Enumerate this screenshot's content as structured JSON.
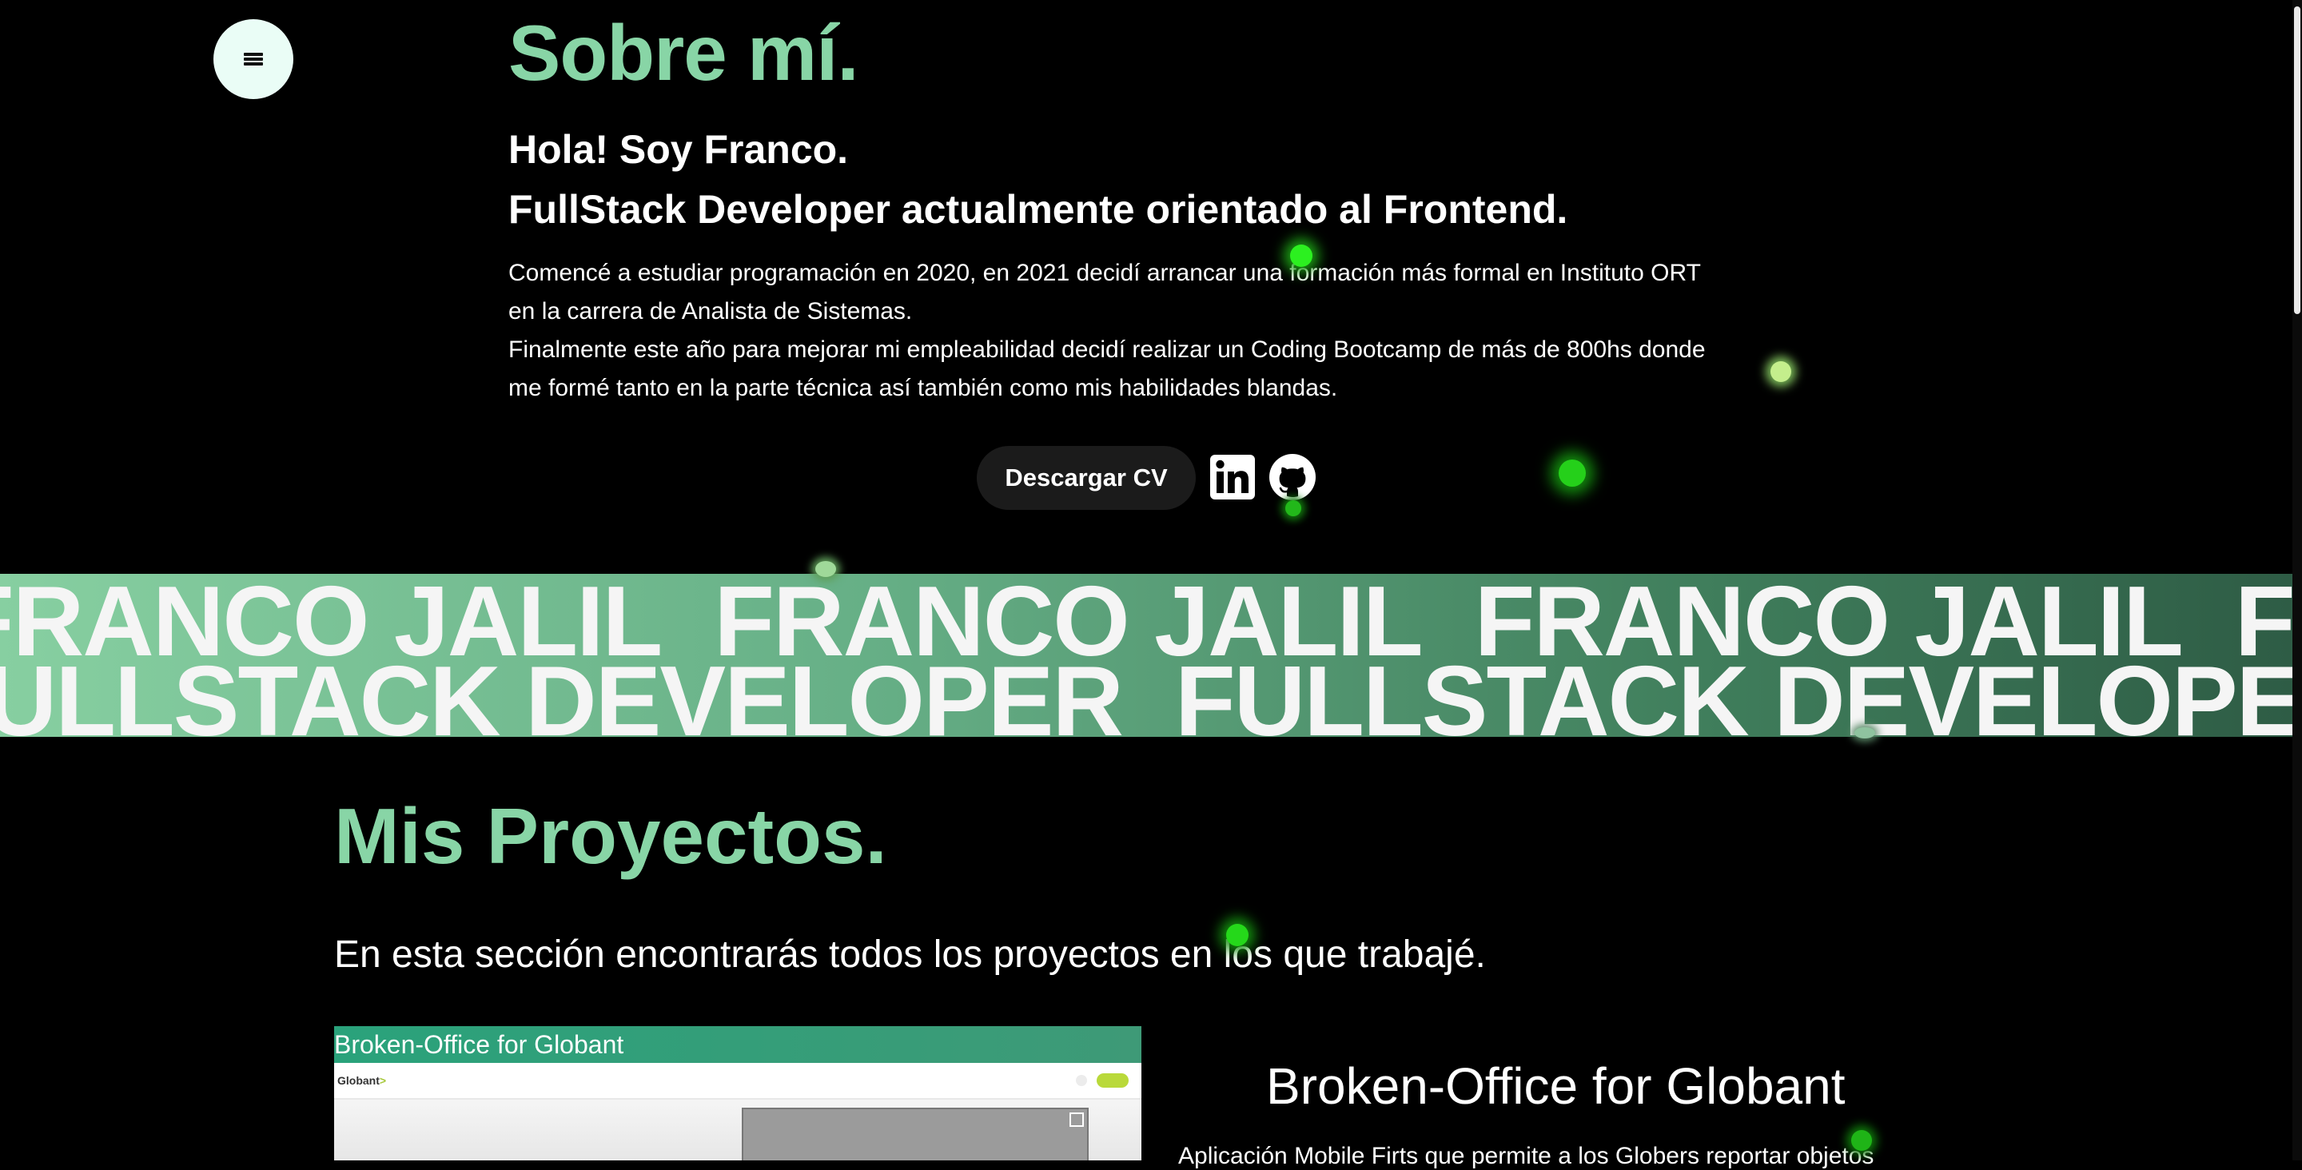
{
  "menu": {
    "icon": "hamburger-icon"
  },
  "about": {
    "title": "Sobre mí.",
    "hello": "Hola! Soy Franco.",
    "role": "FullStack Developer actualmente orientado al Frontend.",
    "paragraph1_line1": "Comencé a estudiar programación en 2020, en 2021 decidí arrancar una formación más formal en Instituto ORT",
    "paragraph1_line2": "en la carrera de Analista de Sistemas.",
    "paragraph2_line1": "Finalmente este año para mejorar mi empleabilidad decidí realizar un Coding Bootcamp de más de 800hs donde",
    "paragraph2_line2": "me formé tanto en la parte técnica así también como mis habilidades blandas.",
    "cv_button": "Descargar CV",
    "social_icons": [
      "linkedin-icon",
      "github-icon"
    ]
  },
  "marquee": {
    "row1_text": "FRANCO JALIL",
    "row2_text": "FULLSTACK DEVELOPER",
    "gradient": [
      "#87cfa1",
      "#2e5c45"
    ]
  },
  "projects": {
    "title": "Mis Proyectos.",
    "intro": "En esta sección encontrarás todos los proyectos en los que trabajé.",
    "card": {
      "header": "Broken-Office for Globant",
      "logo_text": "Globant",
      "logo_mark": ">",
      "name": "Broken-Office for Globant",
      "description": "Aplicación Mobile Firts que permite a los Globers reportar objetos"
    }
  },
  "colors": {
    "accent": "#88d5a6",
    "background": "#000000"
  }
}
